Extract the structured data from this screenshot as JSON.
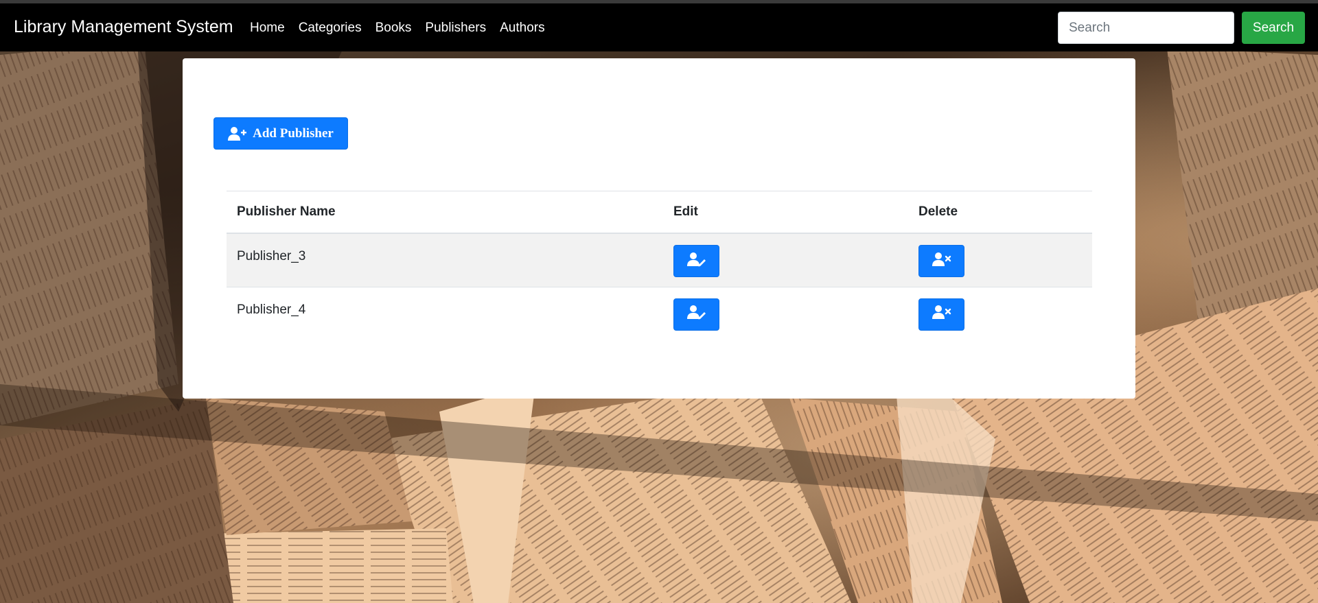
{
  "navbar": {
    "brand": "Library Management System",
    "links": [
      "Home",
      "Categories",
      "Books",
      "Publishers",
      "Authors"
    ],
    "search": {
      "placeholder": "Search",
      "value": "",
      "button_label": "Search"
    }
  },
  "main": {
    "add_button_label": "Add Publisher",
    "table": {
      "headers": [
        "Publisher Name",
        "Edit",
        "Delete"
      ],
      "rows": [
        {
          "name": "Publisher_3"
        },
        {
          "name": "Publisher_4"
        }
      ]
    }
  },
  "colors": {
    "navbar_bg": "#000000",
    "primary": "#0d7bff",
    "success": "#28a745",
    "row_stripe": "#f2f2f2"
  },
  "icons": {
    "add": "user-plus-icon",
    "edit": "user-edit-icon",
    "delete": "user-times-icon"
  }
}
